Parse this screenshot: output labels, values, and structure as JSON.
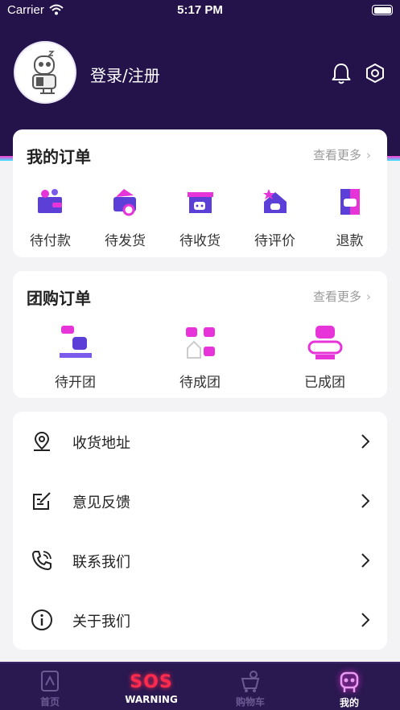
{
  "status_bar": {
    "carrier": "Carrier",
    "time": "5:17 PM"
  },
  "header": {
    "login_label": "登录/注册",
    "bell_icon": "bell-icon",
    "settings_icon": "gear-icon",
    "background_color": "#23134a"
  },
  "orders": {
    "title": "我的订单",
    "more_label": "查看更多",
    "items": [
      {
        "label": "待付款",
        "icon": "wallet-icon"
      },
      {
        "label": "待发货",
        "icon": "shipping-icon"
      },
      {
        "label": "待收货",
        "icon": "delivery-box-icon"
      },
      {
        "label": "待评价",
        "icon": "review-house-icon"
      },
      {
        "label": "退款",
        "icon": "refund-icon"
      }
    ]
  },
  "group_buy": {
    "title": "团购订单",
    "more_label": "查看更多",
    "items": [
      {
        "label": "待开团",
        "icon": "robot-chat-icon"
      },
      {
        "label": "待成团",
        "icon": "robot-group-icon"
      },
      {
        "label": "已成团",
        "icon": "robot-ready-icon"
      }
    ]
  },
  "menu": [
    {
      "label": "收货地址",
      "icon": "location-pin-icon"
    },
    {
      "label": "意见反馈",
      "icon": "edit-note-icon"
    },
    {
      "label": "联系我们",
      "icon": "phone-icon"
    },
    {
      "label": "关于我们",
      "icon": "info-icon"
    }
  ],
  "tabbar": {
    "items": [
      {
        "label": "首页",
        "icon": "home-robot-icon",
        "active": false
      },
      {
        "label": "WARNING",
        "badge": "SOS",
        "icon": "sos-warning-icon",
        "active": false
      },
      {
        "label": "购物车",
        "icon": "cart-robot-icon",
        "active": false
      },
      {
        "label": "我的",
        "icon": "profile-robot-icon",
        "active": true
      }
    ]
  },
  "colors": {
    "accent": "#5b3fd6",
    "brand_magenta": "#e634d8",
    "text": "#222222",
    "muted": "#9a9a9a"
  }
}
